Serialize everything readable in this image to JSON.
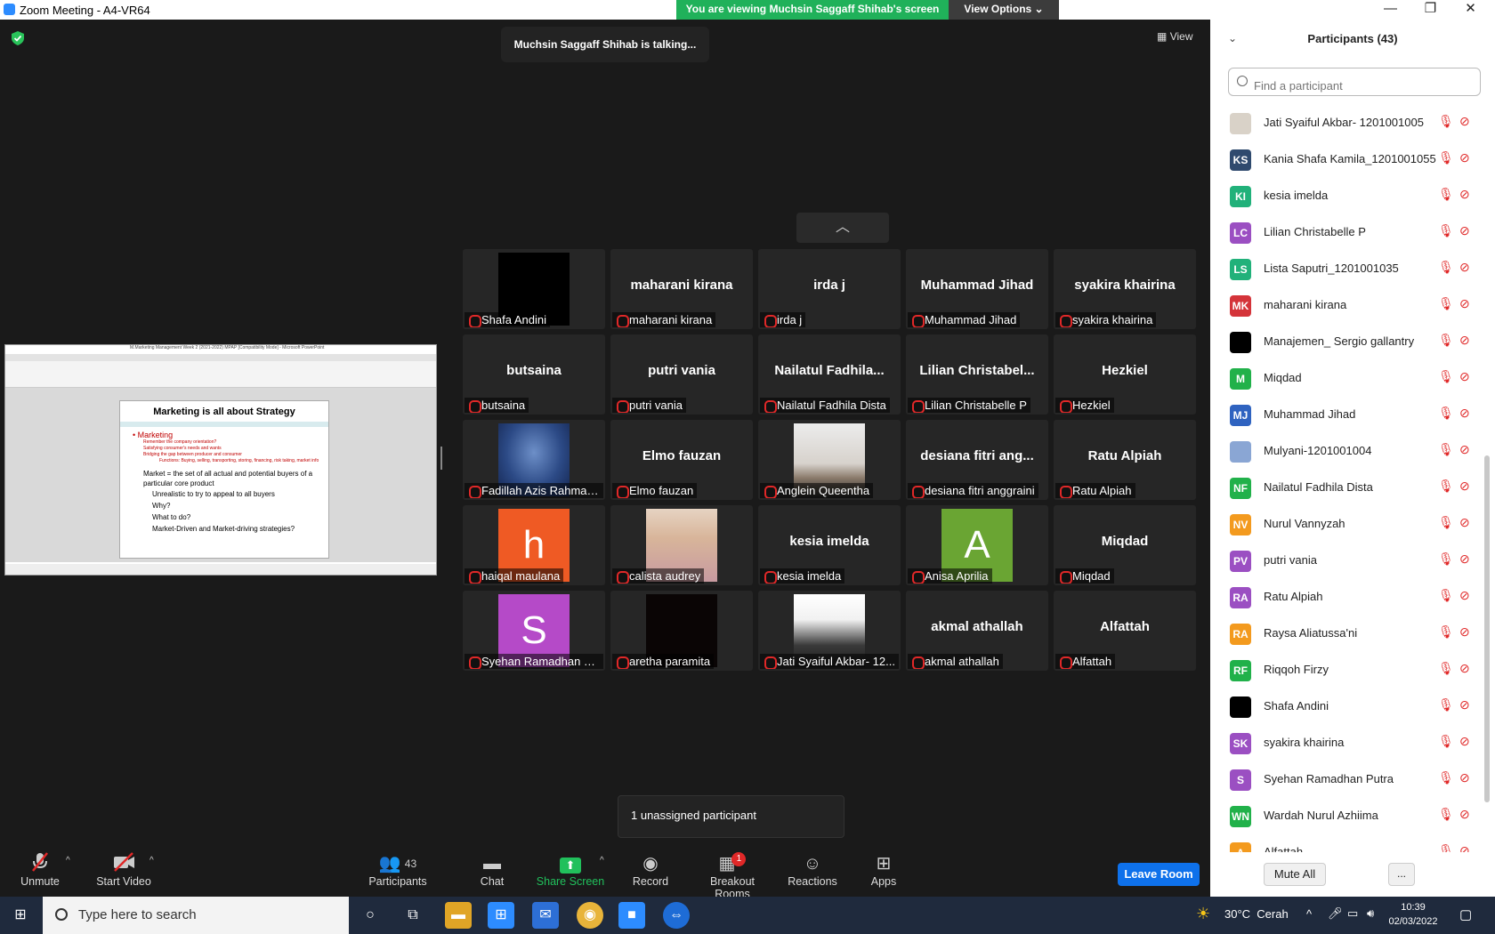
{
  "window": {
    "title": "Zoom Meeting - A4-VR64",
    "minimize": "—",
    "maximize": "❐",
    "close": "✕"
  },
  "banner": {
    "viewing": "You are viewing Muchsin Saggaff Shihab's screen",
    "view_options": "View Options ⌄"
  },
  "talking": "Muchsin Saggaff Shihab is talking...",
  "view_label": "View",
  "share": {
    "window_title": "M.Marketing Management Week 2 (2021-2022) MPAP [Compatibility Mode] - Microsoft PowerPoint",
    "slide_title": "Marketing is all about Strategy",
    "heading": "Marketing",
    "subpoints": [
      "Remember the company orientation?",
      "Satisfying consumer's needs and wants",
      "Bridging the gap between producer and consumer"
    ],
    "subsub": "Functions: Buying, selling, transporting, storing, financing, risk taking, market info",
    "market_line": "Market = the set of all actual and potential buyers of a particular core product",
    "market_points": [
      "Unrealistic to try to appeal to all buyers",
      "Why?",
      "What to do?",
      "Market-Driven and Market-driving strategies?"
    ]
  },
  "tiles": [
    {
      "big": "",
      "label": "Shafa Andini",
      "video": "black"
    },
    {
      "big": "maharani kirana",
      "label": "maharani kirana",
      "video": ""
    },
    {
      "big": "irda j",
      "label": "irda j",
      "video": ""
    },
    {
      "big": "Muhammad Jihad",
      "label": "Muhammad Jihad",
      "video": ""
    },
    {
      "big": "syakira khairina",
      "label": "syakira khairina",
      "video": ""
    },
    {
      "big": "butsaina",
      "label": "butsaina",
      "video": ""
    },
    {
      "big": "putri vania",
      "label": "putri vania",
      "video": ""
    },
    {
      "big": "Nailatul  Fadhila...",
      "label": "Nailatul Fadhila Dista",
      "video": ""
    },
    {
      "big": "Lilian  Christabel...",
      "label": "Lilian Christabelle P",
      "video": ""
    },
    {
      "big": "Hezkiel",
      "label": "Hezkiel",
      "video": ""
    },
    {
      "big": "",
      "label": "Fadillah Azis Rahman ...",
      "video": "blue"
    },
    {
      "big": "Elmo fauzan",
      "label": "Elmo fauzan",
      "video": ""
    },
    {
      "big": "",
      "label": "Anglein Queentha",
      "video": "photo-desk"
    },
    {
      "big": "desiana  fitri  ang...",
      "label": "desiana fitri anggraini",
      "video": ""
    },
    {
      "big": "Ratu Alpiah",
      "label": "Ratu Alpiah",
      "video": ""
    },
    {
      "big": "",
      "label": "haiqal maulana",
      "video": "letter-h"
    },
    {
      "big": "",
      "label": "calista audrey",
      "video": "photo-person"
    },
    {
      "big": "kesia imelda",
      "label": "kesia imelda",
      "video": ""
    },
    {
      "big": "",
      "label": "Anisa Aprilia",
      "video": "letter-a"
    },
    {
      "big": "Miqdad",
      "label": "Miqdad",
      "video": ""
    },
    {
      "big": "",
      "label": "Syehan Ramadhan Pu...",
      "video": "letter-s"
    },
    {
      "big": "",
      "label": "aretha paramita",
      "video": "dark"
    },
    {
      "big": "",
      "label": "Jati Syaiful Akbar- 12...",
      "video": "photo-poster"
    },
    {
      "big": "akmal athallah",
      "label": "akmal athallah",
      "video": ""
    },
    {
      "big": "Alfattah",
      "label": "Alfattah",
      "video": ""
    }
  ],
  "avatar_letters": {
    "letter-h": "h",
    "letter-a": "A",
    "letter-s": "S"
  },
  "unassigned": "1 unassigned participant",
  "toolbar": {
    "unmute": "Unmute",
    "start_video": "Start Video",
    "participants": "Participants",
    "participants_count": "43",
    "chat": "Chat",
    "share_screen": "Share Screen",
    "record": "Record",
    "breakout": "Breakout Rooms",
    "breakout_badge": "1",
    "reactions": "Reactions",
    "apps": "Apps",
    "leave": "Leave Room"
  },
  "panel": {
    "title": "Participants (43)",
    "search_placeholder": "Find a participant",
    "participants": [
      {
        "initials": "",
        "name": "Jati Syaiful Akbar- 1201001005",
        "color": "#d9d2c8"
      },
      {
        "initials": "KS",
        "name": "Kania Shafa Kamila_1201001055",
        "color": "#2f4a6e"
      },
      {
        "initials": "KI",
        "name": "kesia imelda",
        "color": "#21b17a"
      },
      {
        "initials": "LC",
        "name": "Lilian Christabelle P",
        "color": "#9b4fc2"
      },
      {
        "initials": "LS",
        "name": "Lista Saputri_1201001035",
        "color": "#21b17a"
      },
      {
        "initials": "MK",
        "name": "maharani kirana",
        "color": "#d4343a"
      },
      {
        "initials": "",
        "name": "Manajemen_ Sergio gallantry",
        "color": "#000000"
      },
      {
        "initials": "M",
        "name": "Miqdad",
        "color": "#21b14a"
      },
      {
        "initials": "MJ",
        "name": "Muhammad Jihad",
        "color": "#2f63c0"
      },
      {
        "initials": "",
        "name": "Mulyani-1201001004",
        "color": "#8aa6d4"
      },
      {
        "initials": "NF",
        "name": "Nailatul Fadhila Dista",
        "color": "#21b14a"
      },
      {
        "initials": "NV",
        "name": "Nurul Vannyzah",
        "color": "#f39a1e"
      },
      {
        "initials": "PV",
        "name": "putri vania",
        "color": "#9b4fc2"
      },
      {
        "initials": "RA",
        "name": "Ratu Alpiah",
        "color": "#9b4fc2"
      },
      {
        "initials": "RA",
        "name": "Raysa Aliatussa'ni",
        "color": "#f39a1e"
      },
      {
        "initials": "RF",
        "name": "Riqqoh Firzy",
        "color": "#21b14a"
      },
      {
        "initials": "",
        "name": "Shafa Andini",
        "color": "#000000"
      },
      {
        "initials": "SK",
        "name": "syakira khairina",
        "color": "#9b4fc2"
      },
      {
        "initials": "S",
        "name": "Syehan Ramadhan Putra",
        "color": "#9b4fc2"
      },
      {
        "initials": "WN",
        "name": "Wardah Nurul Azhiima",
        "color": "#21b14a"
      },
      {
        "initials": "A",
        "name": "Alfattah",
        "color": "#f39a1e"
      }
    ],
    "mute_all": "Mute All",
    "more": "..."
  },
  "taskbar": {
    "search_placeholder": "Type here to search",
    "weather": "30°C  Cerah",
    "time": "10:39",
    "date": "02/03/2022"
  },
  "colors": {
    "accent": "#0e71eb",
    "banner": "#20b15a",
    "muted": "#e02828"
  }
}
